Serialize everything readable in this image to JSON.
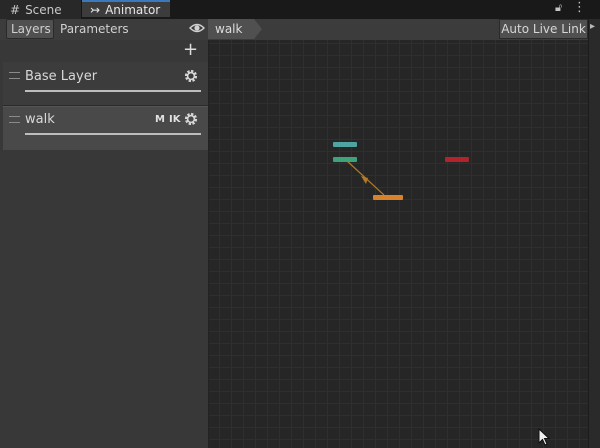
{
  "tabs": [
    {
      "label": "Scene",
      "icon": "grid-icon"
    },
    {
      "label": "Animator",
      "icon": "animator-icon"
    }
  ],
  "toolbar": {
    "layers_label": "Layers",
    "parameters_label": "Parameters",
    "breadcrumb": "walk",
    "auto_live_link_label": "Auto Live Link"
  },
  "layers": [
    {
      "name": "Base Layer",
      "badges": ""
    },
    {
      "name": "walk",
      "badges_m": "M",
      "badges_ik": "IK"
    }
  ],
  "graph": {
    "states": [
      {
        "kind": "entry",
        "color": "#3ea37d"
      },
      {
        "kind": "any-state",
        "color": "#4fa3a0"
      },
      {
        "kind": "default-state",
        "color": "#d8822c"
      },
      {
        "kind": "exit",
        "color": "#b3232a"
      }
    ],
    "transition_color": "#b07a28"
  },
  "colors": {
    "accent_tab": "#3a79bb",
    "background": "#262626"
  }
}
